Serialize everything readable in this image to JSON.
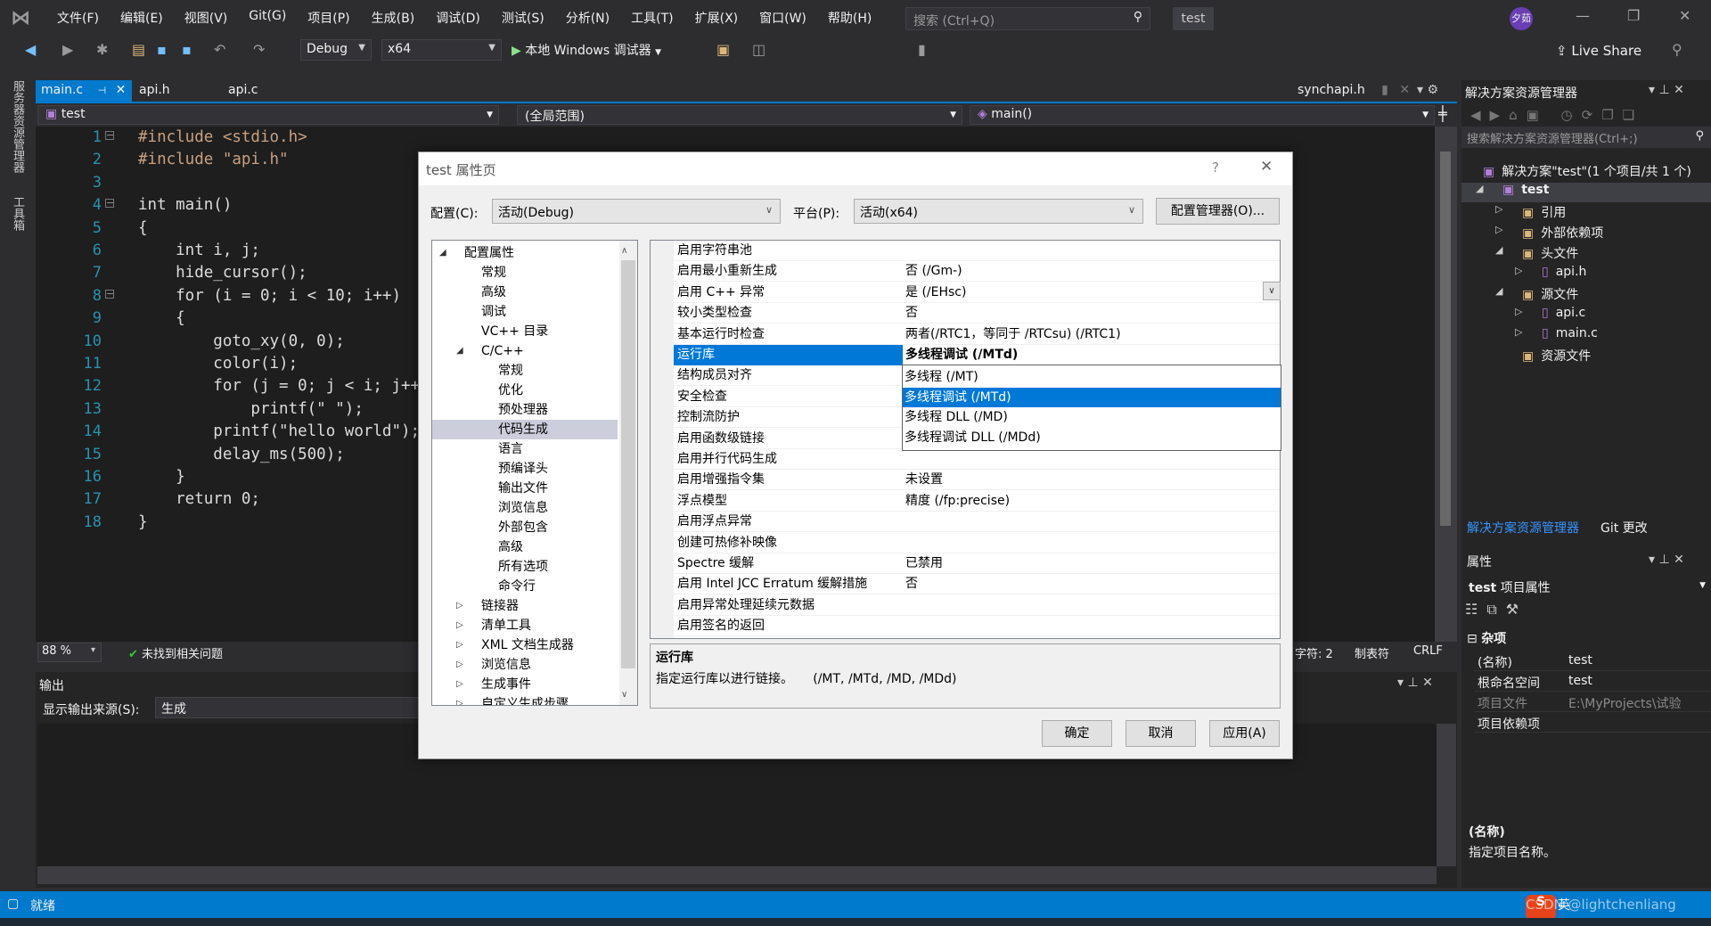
{
  "menubar": {
    "items": [
      "文件(F)",
      "编辑(E)",
      "视图(V)",
      "Git(G)",
      "项目(P)",
      "生成(B)",
      "调试(D)",
      "测试(S)",
      "分析(N)",
      "工具(T)",
      "扩展(X)",
      "窗口(W)",
      "帮助(H)"
    ],
    "search_placeholder": "搜索 (Ctrl+Q)",
    "solution_name": "test",
    "avatar": "夕茹"
  },
  "toolbar": {
    "config": "Debug",
    "platform": "x64",
    "run_label": "本地 Windows 调试器",
    "live_share": "Live Share"
  },
  "left_strip": {
    "tabs": [
      "服务器资源管理器",
      "工具箱"
    ]
  },
  "doc_tabs": [
    {
      "label": "main.c",
      "active": true
    },
    {
      "label": "api.h"
    },
    {
      "label": "api.c"
    }
  ],
  "preview_tab": "synchapi.h",
  "navbar": {
    "project": "test",
    "scope": "(全局范围)",
    "member": "main()"
  },
  "editor": {
    "lines": [
      "#include <stdio.h>",
      "#include \"api.h\"",
      "",
      "int main()",
      "{",
      "    int i, j;",
      "    hide_cursor();",
      "    for (i = 0; i < 10; i++)",
      "    {",
      "        goto_xy(0, 0);",
      "        color(i);",
      "        for (j = 0; j < i; j++",
      "            printf(\" \");",
      "        printf(\"hello world\");",
      "        delay_ms(500);",
      "    }",
      "    return 0;",
      "}"
    ]
  },
  "editor_status": {
    "zoom": "88 %",
    "issues": "未找到相关问题",
    "chars": "字符: 2",
    "tabs": "制表符",
    "eol": "CRLF"
  },
  "output": {
    "title": "输出",
    "source_label": "显示输出来源(S):",
    "source_value": "生成"
  },
  "statusbar": {
    "text": "就绪",
    "ime": "英",
    "watermark": "CSDN @lightchenliang"
  },
  "solution_explorer": {
    "title": "解决方案资源管理器",
    "search_placeholder": "搜索解决方案资源管理器(Ctrl+;)",
    "items": [
      {
        "label": "解决方案\"test\"(1 个项目/共 1 个)",
        "level": 0
      },
      {
        "label": "test",
        "level": 1,
        "bold": true,
        "expanded": true
      },
      {
        "label": "引用",
        "level": 2
      },
      {
        "label": "外部依赖项",
        "level": 2
      },
      {
        "label": "头文件",
        "level": 2,
        "expanded": true
      },
      {
        "label": "api.h",
        "level": 3
      },
      {
        "label": "源文件",
        "level": 2,
        "expanded": true
      },
      {
        "label": "api.c",
        "level": 3
      },
      {
        "label": "main.c",
        "level": 3
      },
      {
        "label": "资源文件",
        "level": 2
      }
    ],
    "tabs": [
      "解决方案资源管理器",
      "Git 更改"
    ]
  },
  "properties": {
    "title": "属性",
    "object": "test",
    "object_type": "项目属性",
    "category": "杂项",
    "rows": [
      {
        "name": "(名称)",
        "value": "test"
      },
      {
        "name": "根命名空间",
        "value": "test"
      },
      {
        "name": "项目文件",
        "value": "E:\\MyProjects\\试验"
      },
      {
        "name": "项目依赖项",
        "value": ""
      }
    ],
    "desc_title": "(名称)",
    "desc_text": "指定项目名称。"
  },
  "dialog": {
    "title": "test 属性页",
    "help": "?",
    "config_label": "配置(C):",
    "config_value": "活动(Debug)",
    "platform_label": "平台(P):",
    "platform_value": "活动(x64)",
    "config_manager": "配置管理器(O)...",
    "tree": [
      {
        "label": "配置属性",
        "level": 0,
        "expanded": true
      },
      {
        "label": "常规",
        "level": 1
      },
      {
        "label": "高级",
        "level": 1
      },
      {
        "label": "调试",
        "level": 1
      },
      {
        "label": "VC++ 目录",
        "level": 1
      },
      {
        "label": "C/C++",
        "level": 1,
        "expanded": true
      },
      {
        "label": "常规",
        "level": 2
      },
      {
        "label": "优化",
        "level": 2
      },
      {
        "label": "预处理器",
        "level": 2
      },
      {
        "label": "代码生成",
        "level": 2,
        "selected": true
      },
      {
        "label": "语言",
        "level": 2
      },
      {
        "label": "预编译头",
        "level": 2
      },
      {
        "label": "输出文件",
        "level": 2
      },
      {
        "label": "浏览信息",
        "level": 2
      },
      {
        "label": "外部包含",
        "level": 2
      },
      {
        "label": "高级",
        "level": 2
      },
      {
        "label": "所有选项",
        "level": 2
      },
      {
        "label": "命令行",
        "level": 2
      },
      {
        "label": "链接器",
        "level": 1,
        "collapsed": true
      },
      {
        "label": "清单工具",
        "level": 1,
        "collapsed": true
      },
      {
        "label": "XML 文档生成器",
        "level": 1,
        "collapsed": true
      },
      {
        "label": "浏览信息",
        "level": 1,
        "collapsed": true
      },
      {
        "label": "生成事件",
        "level": 1,
        "collapsed": true
      },
      {
        "label": "自定义生成步骤",
        "level": 1,
        "collapsed": true
      }
    ],
    "props": [
      {
        "name": "启用字符串池",
        "value": ""
      },
      {
        "name": "启用最小重新生成",
        "value": "否 (/Gm-)"
      },
      {
        "name": "启用 C++ 异常",
        "value": "是 (/EHsc)"
      },
      {
        "name": "较小类型检查",
        "value": "否"
      },
      {
        "name": "基本运行时检查",
        "value": "两者(/RTC1，等同于 /RTCsu) (/RTC1)"
      },
      {
        "name": "运行库",
        "value": "多线程调试 (/MTd)",
        "selected": true
      },
      {
        "name": "结构成员对齐",
        "value": ""
      },
      {
        "name": "安全检查",
        "value": ""
      },
      {
        "name": "控制流防护",
        "value": ""
      },
      {
        "name": "启用函数级链接",
        "value": ""
      },
      {
        "name": "启用并行代码生成",
        "value": ""
      },
      {
        "name": "启用增强指令集",
        "value": "未设置"
      },
      {
        "name": "浮点模型",
        "value": "精度 (/fp:precise)"
      },
      {
        "name": "启用浮点异常",
        "value": ""
      },
      {
        "name": "创建可热修补映像",
        "value": ""
      },
      {
        "name": "Spectre 缓解",
        "value": "已禁用"
      },
      {
        "name": "启用 Intel JCC Erratum 缓解措施",
        "value": "否"
      },
      {
        "name": "启用异常处理延续元数据",
        "value": ""
      },
      {
        "name": "启用签名的返回",
        "value": ""
      }
    ],
    "dropdown_options": [
      "多线程 (/MT)",
      "多线程调试 (/MTd)",
      "多线程 DLL (/MD)",
      "多线程调试 DLL (/MDd)"
    ],
    "dropdown_selected": 1,
    "desc_title": "运行库",
    "desc_text": "指定运行库以进行链接。     (/MT, /MTd, /MD, /MDd)",
    "ok": "确定",
    "cancel": "取消",
    "apply": "应用(A)"
  },
  "colors": {
    "accent": "#007acc",
    "selection": "#0078d7",
    "editor_bg": "#1e1e1e"
  }
}
